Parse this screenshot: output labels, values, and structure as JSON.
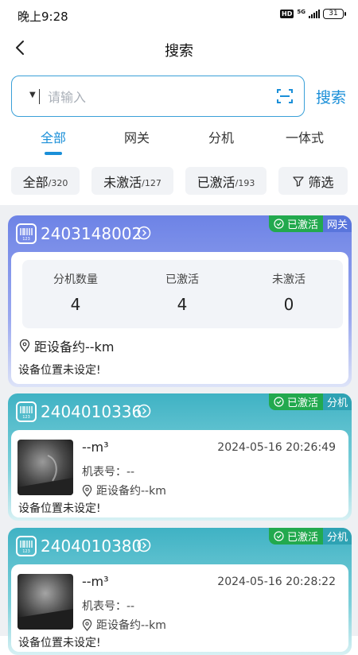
{
  "status_bar": {
    "time": "晚上9:28",
    "hd": "HD",
    "network": "5G",
    "battery": "31"
  },
  "header": {
    "title": "搜索"
  },
  "search": {
    "placeholder": "请输入",
    "value": "",
    "button_label": "搜索"
  },
  "tabs": [
    {
      "label": "全部",
      "active": true
    },
    {
      "label": "网关",
      "active": false
    },
    {
      "label": "分机",
      "active": false
    },
    {
      "label": "一体式",
      "active": false
    }
  ],
  "filters": {
    "all": {
      "label": "全部",
      "count": "/320"
    },
    "inactive": {
      "label": "未激活",
      "count": "/127"
    },
    "active": {
      "label": "已激活",
      "count": "/193"
    },
    "filter_label": "筛选"
  },
  "cards": [
    {
      "id": "2403148002",
      "status": "已激活",
      "type": "网关",
      "stats": [
        {
          "label": "分机数量",
          "value": "4"
        },
        {
          "label": "已激活",
          "value": "4"
        },
        {
          "label": "未激活",
          "value": "0"
        }
      ],
      "distance": "距设备约--km",
      "note": "设备位置未设定!"
    },
    {
      "id": "2404010336",
      "status": "已激活",
      "type": "分机",
      "volume": "--m³",
      "timestamp": "2024-05-16 20:26:49",
      "meter_no": "机表号：--",
      "distance": "距设备约--km",
      "note": "设备位置未设定!"
    },
    {
      "id": "2404010380",
      "status": "已激活",
      "type": "分机",
      "volume": "--m³",
      "timestamp": "2024-05-16 20:28:22",
      "meter_no": "机表号：--",
      "distance": "距设备约--km",
      "note": "设备位置未设定!"
    }
  ],
  "colors": {
    "accent": "#1a8fd8",
    "active_badge": "#22a94e",
    "gateway": "#6d83e6",
    "extension": "#3fb2c4"
  }
}
